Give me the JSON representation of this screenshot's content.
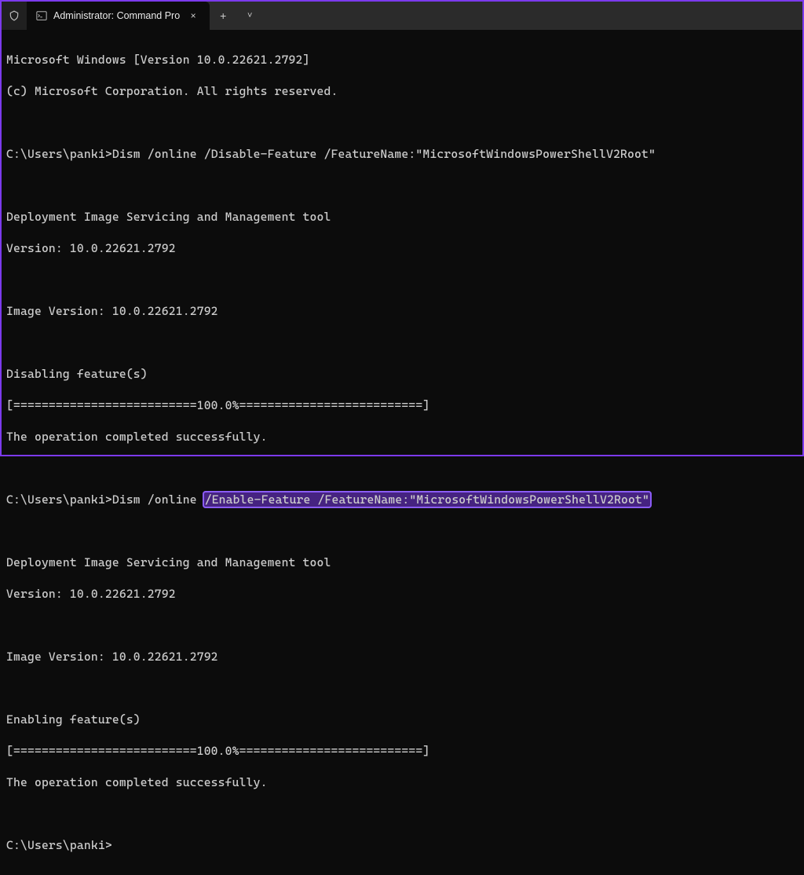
{
  "titlebar": {
    "tab_title": "Administrator: Command Pro",
    "close_glyph": "×",
    "new_tab_glyph": "+",
    "dropdown_glyph": "˅"
  },
  "terminal": {
    "l01": "Microsoft Windows [Version 10.0.22621.2792]",
    "l02": "(c) Microsoft Corporation. All rights reserved.",
    "l03": "",
    "l04_prompt": "C:\\Users\\panki>",
    "l04_cmd": "Dism /online /Disable-Feature /FeatureName:\"MicrosoftWindowsPowerShellV2Root\"",
    "l05": "",
    "l06": "Deployment Image Servicing and Management tool",
    "l07": "Version: 10.0.22621.2792",
    "l08": "",
    "l09": "Image Version: 10.0.22621.2792",
    "l10": "",
    "l11": "Disabling feature(s)",
    "l12": "[==========================100.0%==========================]",
    "l13": "The operation completed successfully.",
    "l14": "",
    "l15_prompt": "C:\\Users\\panki>",
    "l15_cmd_pre": "Dism /online ",
    "l15_cmd_hl": "/Enable-Feature /FeatureName:\"MicrosoftWindowsPowerShellV2Root\"",
    "l16": "",
    "l17": "Deployment Image Servicing and Management tool",
    "l18": "Version: 10.0.22621.2792",
    "l19": "",
    "l20": "Image Version: 10.0.22621.2792",
    "l21": "",
    "l22": "Enabling feature(s)",
    "l23": "[==========================100.0%==========================]",
    "l24": "The operation completed successfully.",
    "l25": "",
    "l26": "C:\\Users\\panki>"
  }
}
